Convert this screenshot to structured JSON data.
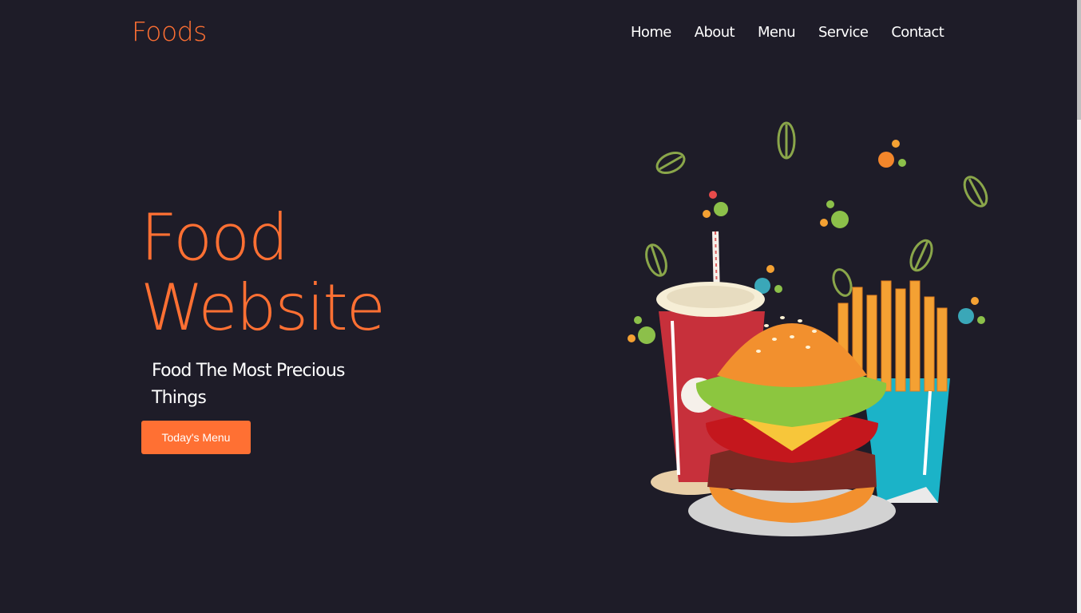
{
  "header": {
    "logo": "Foods",
    "nav": [
      "Home",
      "About",
      "Menu",
      "Service",
      "Contact"
    ]
  },
  "hero": {
    "title_line1": "Food",
    "title_line2": "Website",
    "subtitle": "Food The Most Precious Things",
    "cta_label": "Today's Menu"
  },
  "colors": {
    "background": "#1e1c28",
    "accent": "#ff7033",
    "text": "#ffffff"
  },
  "illustration": {
    "name": "burger-fries-drink-illustration"
  }
}
